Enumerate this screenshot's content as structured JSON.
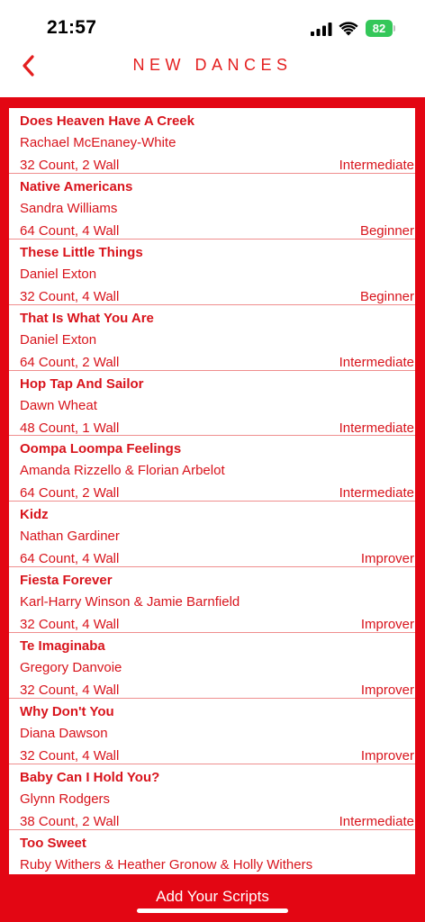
{
  "status": {
    "time": "21:57",
    "battery": "82"
  },
  "nav": {
    "title": "NEW DANCES"
  },
  "dances": [
    {
      "name": "Does Heaven Have A Creek",
      "choreographer": "Rachael McEnaney-White",
      "count": "32 Count, 2 Wall",
      "level": "Intermediate"
    },
    {
      "name": "Native Americans",
      "choreographer": "Sandra Williams",
      "count": "64 Count, 4 Wall",
      "level": "Beginner"
    },
    {
      "name": "These Little Things",
      "choreographer": "Daniel Exton",
      "count": "32 Count, 4 Wall",
      "level": "Beginner"
    },
    {
      "name": "That Is What You Are",
      "choreographer": "Daniel Exton",
      "count": "64 Count, 2 Wall",
      "level": "Intermediate"
    },
    {
      "name": "Hop Tap And Sailor",
      "choreographer": "Dawn Wheat",
      "count": "48 Count, 1 Wall",
      "level": "Intermediate"
    },
    {
      "name": "Oompa Loompa Feelings",
      "choreographer": "Amanda Rizzello & Florian Arbelot",
      "count": "64 Count, 2 Wall",
      "level": "Intermediate"
    },
    {
      "name": "Kidz",
      "choreographer": "Nathan Gardiner",
      "count": "64 Count, 4 Wall",
      "level": "Improver"
    },
    {
      "name": "Fiesta Forever",
      "choreographer": "Karl-Harry Winson & Jamie Barnfield",
      "count": "32 Count, 4 Wall",
      "level": "Improver"
    },
    {
      "name": "Te Imaginaba",
      "choreographer": "Gregory Danvoie",
      "count": "32 Count, 4 Wall",
      "level": "Improver"
    },
    {
      "name": "Why Don't You",
      "choreographer": "Diana Dawson",
      "count": "32 Count, 4 Wall",
      "level": "Improver"
    },
    {
      "name": "Baby Can I Hold You?",
      "choreographer": "Glynn Rodgers",
      "count": "38 Count, 2 Wall",
      "level": "Intermediate"
    },
    {
      "name": "Too Sweet",
      "choreographer": "Ruby Withers & Heather Gronow & Holly Withers",
      "count": "",
      "level": ""
    }
  ],
  "footer": {
    "label": "Add Your Scripts"
  },
  "colors": {
    "accent": "#e30613",
    "text": "#d8141c"
  }
}
